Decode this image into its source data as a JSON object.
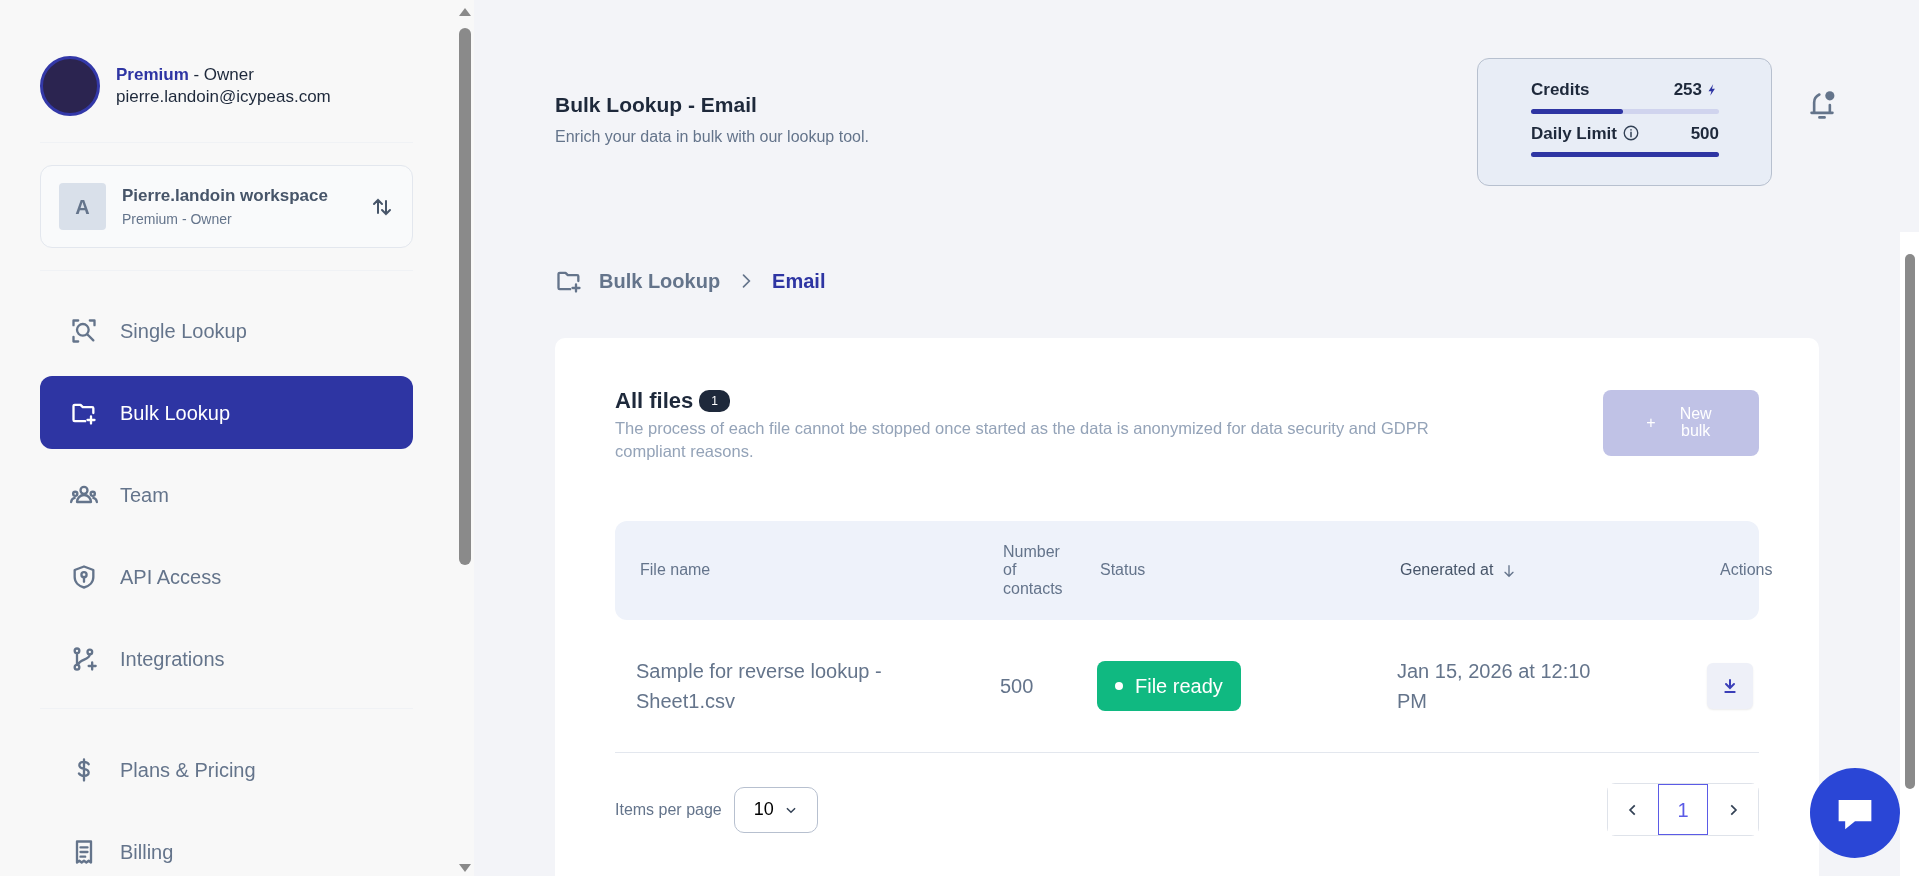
{
  "profile": {
    "plan": "Premium",
    "role": "- Owner",
    "email": "pierre.landoin@icypeas.com"
  },
  "workspace": {
    "initial": "A",
    "name": "Pierre.landoin workspace",
    "subtitle": "Premium - Owner"
  },
  "nav_groups": [
    [
      {
        "label": "Single Lookup",
        "selected": false
      },
      {
        "label": "Bulk Lookup",
        "selected": true
      },
      {
        "label": "Team",
        "selected": false
      },
      {
        "label": "API Access",
        "selected": false
      },
      {
        "label": "Integrations",
        "selected": false
      }
    ],
    [
      {
        "label": "Plans & Pricing",
        "selected": false
      },
      {
        "label": "Billing",
        "selected": false
      }
    ]
  ],
  "header": {
    "title": "Bulk Lookup - Email",
    "subtitle": "Enrich your data in bulk with our lookup tool."
  },
  "meters": [
    {
      "label": "Credits",
      "value": "253",
      "level": 0.49
    },
    {
      "label": "Daily Limit",
      "value": "500",
      "level": 1
    }
  ],
  "breadcrumb": [
    {
      "label": "Bulk Lookup",
      "selected": false
    },
    {
      "label": "Email",
      "selected": true
    }
  ],
  "files": {
    "title": "All files",
    "count": "1",
    "description": "The process of each file cannot be stopped once started as the data is anonymized for data security and GDPR compliant reasons.",
    "new_button": {
      "icon_text": "+",
      "label": "New bulk",
      "disabled": true
    }
  },
  "table": {
    "columns": [
      {
        "label": "File name",
        "sorted": false
      },
      {
        "label": "Number of contacts",
        "sorted": false
      },
      {
        "label": "Status",
        "sorted": false
      },
      {
        "label": "Generated at",
        "sorted": true
      },
      {
        "label": "Actions",
        "sorted": false
      }
    ],
    "rows": [
      {
        "file_name": "Sample for reverse lookup - Sheet1.csv",
        "contacts": "500",
        "status": "File ready",
        "generated_at": "Jan 15, 2026 at 12:10 PM"
      }
    ]
  },
  "pagination": {
    "items_label": "Items per page",
    "page_size": "10",
    "pages": [
      {
        "label": "1",
        "selected": true
      }
    ]
  }
}
